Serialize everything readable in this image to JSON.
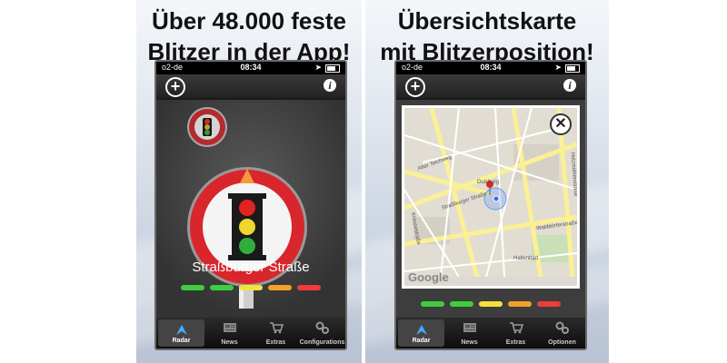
{
  "left_panel": {
    "headline_line1": "Über 48.000 feste",
    "headline_line2": "Blitzer in der App!",
    "status": {
      "carrier": "o2-de",
      "time": "08:34"
    },
    "street_name": "Straßburger Straße",
    "tabs": [
      {
        "label": "Radar",
        "icon": "radar-icon"
      },
      {
        "label": "News",
        "icon": "news-icon"
      },
      {
        "label": "Extras",
        "icon": "cart-icon"
      },
      {
        "label": "Configurations",
        "icon": "gears-icon"
      }
    ]
  },
  "right_panel": {
    "headline_line1": "Übersichtskarte",
    "headline_line2": "mit Blitzerposition!",
    "status": {
      "carrier": "o2-de",
      "time": "08:34"
    },
    "map_labels": {
      "duisburg": "Duisburg",
      "strassburger": "Straßburger Straße",
      "alter_teichweg": "Alter Teichweg",
      "walddoerfer": "Walddörferstraße",
      "hallenbad": "Hallenbad",
      "krausestrasse": "Krausestraße",
      "holzmuehlen": "Holzmühlenstraße",
      "google": "Google"
    },
    "tabs": [
      {
        "label": "Radar",
        "icon": "radar-icon"
      },
      {
        "label": "News",
        "icon": "news-icon"
      },
      {
        "label": "Extras",
        "icon": "cart-icon"
      },
      {
        "label": "Optionen",
        "icon": "gears-icon"
      }
    ]
  },
  "colors": {
    "meter": [
      "#3ecf3e",
      "#3ecf3e",
      "#f2e33a",
      "#f3a12b",
      "#ef3b3b"
    ],
    "sign_red": "#d8262c",
    "map_road": "#fbf095"
  }
}
